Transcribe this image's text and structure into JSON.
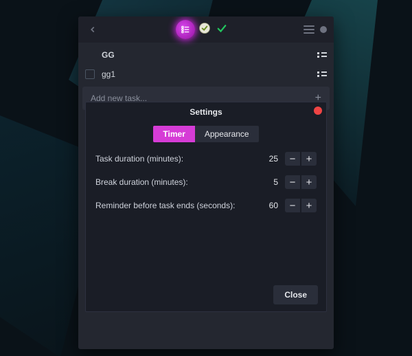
{
  "tasks": {
    "group_label": "GG",
    "item_label": "gg1"
  },
  "modal": {
    "title": "Settings",
    "tabs": {
      "timer": "Timer",
      "appearance": "Appearance"
    },
    "rows": {
      "task_duration": {
        "label": "Task duration (minutes):",
        "value": "25"
      },
      "break_duration": {
        "label": "Break duration (minutes):",
        "value": "5"
      },
      "reminder": {
        "label": "Reminder before task ends (seconds):",
        "value": "60"
      }
    },
    "close_label": "Close"
  },
  "add_bar": {
    "placeholder": "Add new task..."
  },
  "glyphs": {
    "minus": "−",
    "plus": "+"
  }
}
